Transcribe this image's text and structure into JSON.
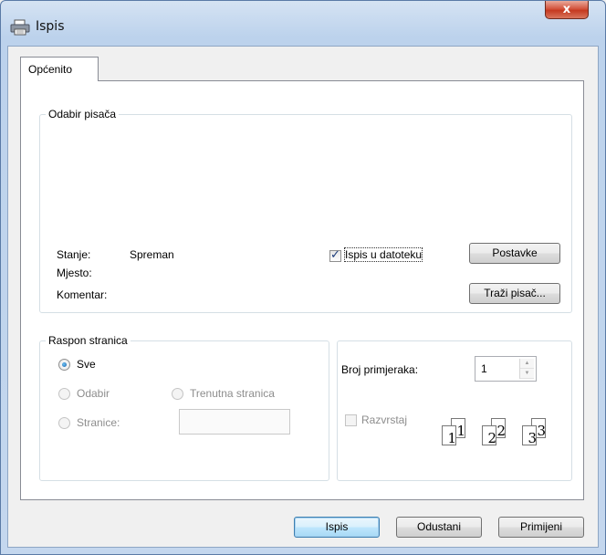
{
  "window": {
    "title": "Ispis",
    "close_label": "x"
  },
  "tabs": [
    {
      "label": "Općenito"
    }
  ],
  "printer_group": {
    "title": "Odabir pisača",
    "status_label": "Stanje:",
    "status_value": "Spreman",
    "location_label": "Mjesto:",
    "comment_label": "Komentar:",
    "print_to_file": {
      "label_pre": "",
      "label": "Ispis u datoteku",
      "checked": true
    },
    "preferences_button": "Postavke",
    "find_printer_button": "Traži pisač..."
  },
  "page_range_group": {
    "title": "Raspon stranica",
    "all_label": "Sve",
    "selection_label": "Odabir",
    "current_page_label": "Trenutna stranica",
    "pages_label": "Stranice:",
    "pages_value": ""
  },
  "copies_group": {
    "copies_label": "Broj primjeraka:",
    "copies_value": "1",
    "collate_label": "Razvrstaj",
    "collate_checked": false,
    "collate_icon_pages": [
      "1",
      "1",
      "2",
      "2",
      "3",
      "3"
    ]
  },
  "footer": {
    "print_button": "Ispis",
    "cancel_button": "Odustani",
    "apply_button": "Primijeni"
  }
}
